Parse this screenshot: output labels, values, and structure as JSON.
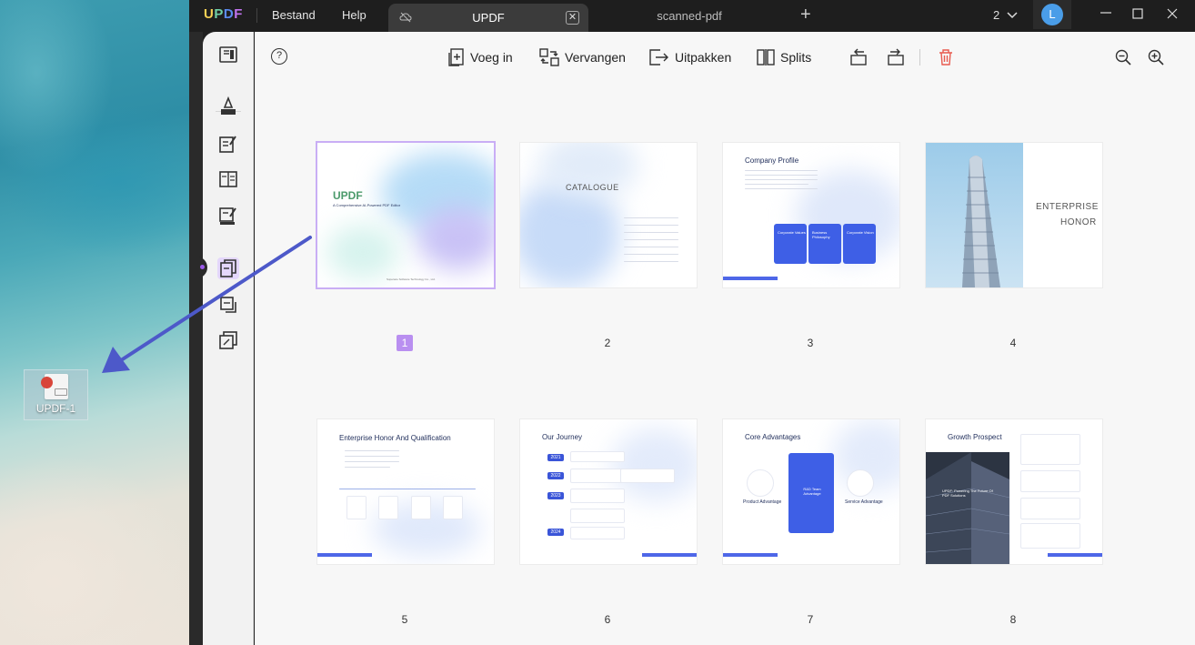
{
  "desktop": {
    "file_icon_label": "UPDF-1"
  },
  "titlebar": {
    "logo": [
      "U",
      "P",
      "D",
      "F"
    ],
    "menu": [
      "Bestand",
      "Help"
    ],
    "active_tab": "UPDF",
    "inactive_tab": "scanned-pdf",
    "new_tab_symbol": "+",
    "window_count": "2",
    "avatar_initial": "L",
    "window_buttons": [
      "minimize-icon",
      "maximize-icon",
      "close-icon"
    ]
  },
  "rail": {
    "icons": [
      "reader-icon",
      "comment-icon",
      "edit-icon",
      "form-icon",
      "sign-icon",
      "organize-pages-icon",
      "tools-icon",
      "layers-icon"
    ]
  },
  "toolbar": {
    "help": "?",
    "insert": "Voeg in",
    "replace": "Vervangen",
    "extract": "Uitpakken",
    "split": "Splits",
    "zoom_out": "zoom-out-icon",
    "zoom_in": "zoom-in-icon"
  },
  "colors": {
    "accent": "#b98ff0",
    "delete": "#e85a4f",
    "brand_blue": "#3e5fe6"
  },
  "pages": [
    {
      "number": "1",
      "selected": true,
      "title": "UPDF",
      "subtitle": "A Comprehensive AI-Powered PDF Editor",
      "footer": "Superace Software Technology Co., Ltd."
    },
    {
      "number": "2",
      "title": "CATALOGUE"
    },
    {
      "number": "3",
      "title": "Company Profile",
      "cards": [
        "Corporate Values",
        "Business Philosophy",
        "Corporate Vision"
      ]
    },
    {
      "number": "4",
      "title_line1": "ENTERPRISE",
      "title_line2": "HONOR"
    },
    {
      "number": "5",
      "title": "Enterprise Honor And Qualification"
    },
    {
      "number": "6",
      "title": "Our Journey",
      "years": [
        "2021",
        "2022",
        "2023",
        "2024"
      ]
    },
    {
      "number": "7",
      "title": "Core Advantages",
      "left_label": "Product Advantage",
      "center_label": "R&D Team Advantage",
      "right_label": "Service Advantage"
    },
    {
      "number": "8",
      "title": "Growth Prospect",
      "overlay": "UPDF: Powering The Future Of PDF Solutions"
    }
  ]
}
